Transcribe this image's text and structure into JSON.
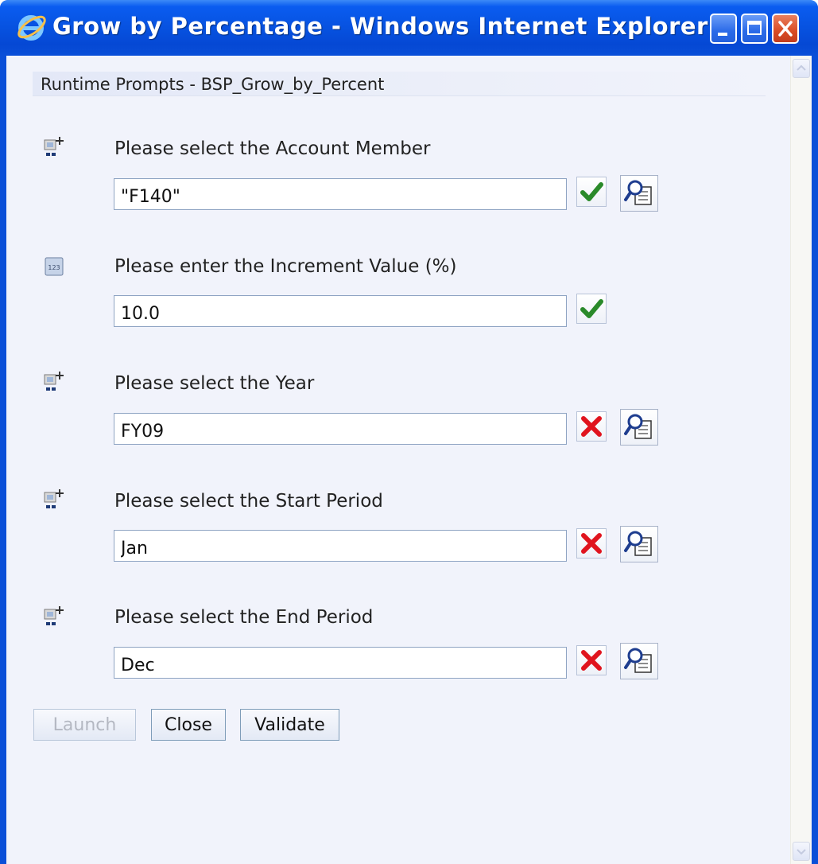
{
  "window": {
    "title": "Grow by Percentage - Windows Internet Explorer",
    "controls": [
      "minimize-icon",
      "maximize-icon",
      "close-icon"
    ]
  },
  "page": {
    "header": "Runtime Prompts - BSP_Grow_by_Percent"
  },
  "prompts": [
    {
      "label": "Please select the Account Member",
      "value": "\"F140\"",
      "type_icon": "member-selection-icon",
      "status": "valid",
      "has_lookup": true
    },
    {
      "label": "Please enter the Increment Value (%)",
      "value": "10.0",
      "type_icon": "numeric-123-icon",
      "status": "valid",
      "has_lookup": false
    },
    {
      "label": "Please select the Year",
      "value": "FY09",
      "type_icon": "member-selection-icon",
      "status": "invalid",
      "has_lookup": true
    },
    {
      "label": "Please select the Start Period",
      "value": "Jan",
      "type_icon": "member-selection-icon",
      "status": "invalid",
      "has_lookup": true
    },
    {
      "label": "Please select the End Period",
      "value": "Dec",
      "type_icon": "member-selection-icon",
      "status": "invalid",
      "has_lookup": true
    }
  ],
  "buttons": {
    "launch": "Launch",
    "close": "Close",
    "validate": "Validate"
  },
  "colors": {
    "titlebar": "#0a4fd8",
    "valid_check": "#2a8a2a",
    "invalid_x": "#e0141e",
    "page_background": "#f1f3fb"
  }
}
